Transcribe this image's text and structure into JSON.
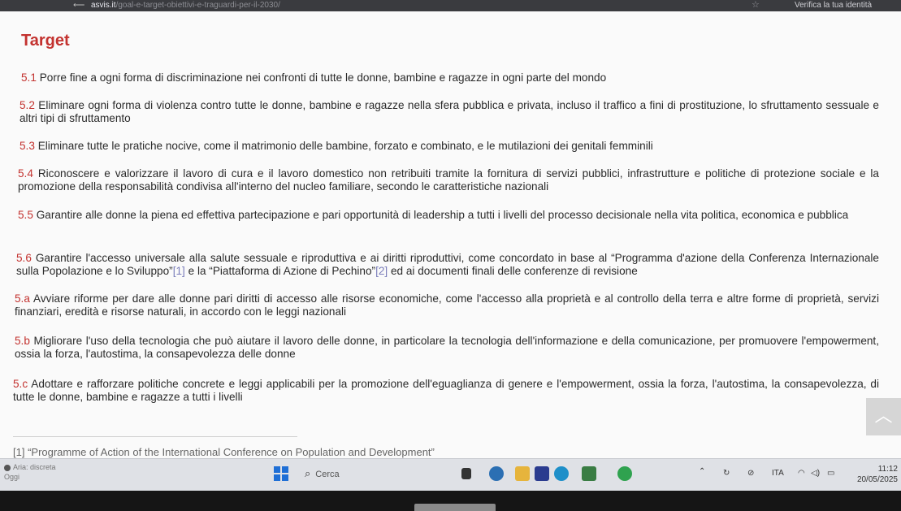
{
  "browser": {
    "url_host": "asvis.it",
    "url_path": "/goal-e-target-obiettivi-e-traguardi-per-il-2030/",
    "verify_label": "Verifica la tua identità"
  },
  "page": {
    "title": "Target",
    "targets": [
      {
        "num": "5.1",
        "text": "Porre fine a ogni forma di discriminazione nei confronti di tutte le donne, bambine e ragazze in ogni parte del mondo"
      },
      {
        "num": "5.2",
        "text": "Eliminare ogni forma di violenza contro tutte le donne, bambine e ragazze nella sfera pubblica e privata, incluso il traffico a fini di prostituzione, lo sfruttamento sessuale e altri tipi di sfruttamento"
      },
      {
        "num": "5.3",
        "text": "Eliminare tutte le pratiche nocive, come il matrimonio delle bambine, forzato e combinato, e le mutilazioni dei genitali femminili"
      },
      {
        "num": "5.4",
        "text": "Riconoscere e valorizzare il lavoro di cura e il lavoro domestico non retribuiti tramite la fornitura di servizi pubblici, infrastrutture e politiche di protezione sociale e la promozione della responsabilità condivisa all'interno del nucleo familiare, secondo le caratteristiche nazionali"
      },
      {
        "num": "5.5",
        "text": "Garantire alle donne la piena ed effettiva partecipazione e pari opportunità di leadership a tutti i livelli del processo decisionale nella vita politica, economica e pubblica"
      },
      {
        "num": "5.6",
        "text_a": "Garantire l'accesso universale alla salute sessuale e riproduttiva e ai diritti riproduttivi, come concordato in base al “Programma d'azione della Conferenza Internazionale sulla Popolazione e lo Sviluppo”",
        "ref1": "[1]",
        "text_b": " e la “Piattaforma di Azione di Pechino”",
        "ref2": "[2]",
        "text_c": " ed ai documenti finali delle conferenze di revisione"
      },
      {
        "num": "5.a",
        "text": "Avviare riforme per dare alle donne pari diritti di accesso alle risorse economiche, come l'accesso alla proprietà e al controllo della terra e altre forme di proprietà, servizi finanziari, eredità e risorse naturali, in accordo con le leggi nazionali"
      },
      {
        "num": "5.b",
        "text": "Migliorare l'uso della tecnologia che può aiutare il lavoro delle donne, in particolare la tecnologia dell'informazione e della comunicazione, per promuovere l'empowerment, ossia la forza, l'autostima, la consapevolezza delle donne"
      },
      {
        "num": "5.c",
        "text": "Adottare e rafforzare politiche concrete e leggi applicabili per la promozione dell'eguaglianza di genere e l'empowerment, ossia la forza, l'autostima, la consapevolezza, di tutte le donne, bambine e ragazze a tutti i livelli"
      }
    ],
    "footnote": "[1] “Programme of Action of the International Conference on Population and Development”"
  },
  "taskbar": {
    "weather_line1": "Aria: discreta",
    "weather_line2": "Oggi",
    "search_placeholder": "Cerca",
    "language": "ITA",
    "time": "11:12",
    "date": "20/05/2025"
  },
  "colors": {
    "accent_red": "#c3322f",
    "link": "#7a7dba",
    "windows_blue": "#1f6fd6"
  }
}
